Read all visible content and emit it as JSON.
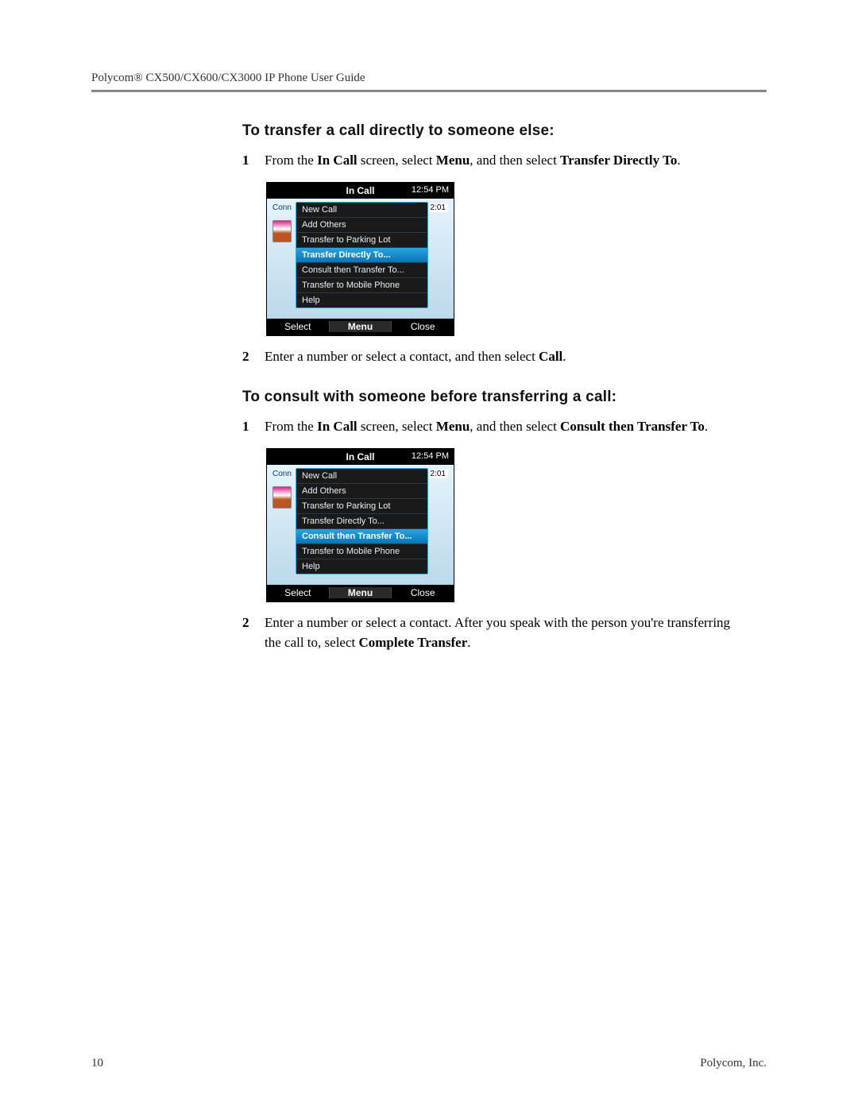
{
  "header": "Polycom® CX500/CX600/CX3000 IP Phone User Guide",
  "section1": {
    "heading": "To transfer a call directly to someone else:",
    "step1_a": "From the ",
    "step1_b1": "In Call",
    "step1_c": " screen, select ",
    "step1_b2": "Menu",
    "step1_d": ", and then select ",
    "step1_b3": "Transfer Directly To",
    "step1_e": ".",
    "step2_a": "Enter a number or select a contact, and then select ",
    "step2_b": "Call",
    "step2_c": "."
  },
  "section2": {
    "heading": "To consult with someone before transferring a call:",
    "step1_a": "From the ",
    "step1_b1": "In Call",
    "step1_c": " screen, select ",
    "step1_b2": "Menu",
    "step1_d": ", and then select ",
    "step1_b3": "Consult then Transfer To",
    "step1_e": ".",
    "step2_a": "Enter a number or select a contact. After you speak with the person you're transferring the call to, select ",
    "step2_b": "Complete Transfer",
    "step2_c": "."
  },
  "phone": {
    "title": "In Call",
    "time": "12:54 PM",
    "status": "Conn",
    "duration": "2:01",
    "softkeys": {
      "left": "Select",
      "mid": "Menu",
      "right": "Close"
    },
    "menu": {
      "new_call": "New Call",
      "add_others": "Add Others",
      "transfer_parking": "Transfer to Parking Lot",
      "transfer_direct": "Transfer Directly To...",
      "consult_transfer": "Consult then Transfer To...",
      "transfer_mobile": "Transfer to Mobile Phone",
      "help": "Help"
    }
  },
  "step_labels": {
    "one": "1",
    "two": "2"
  },
  "footer": {
    "page": "10",
    "company": "Polycom, Inc."
  }
}
